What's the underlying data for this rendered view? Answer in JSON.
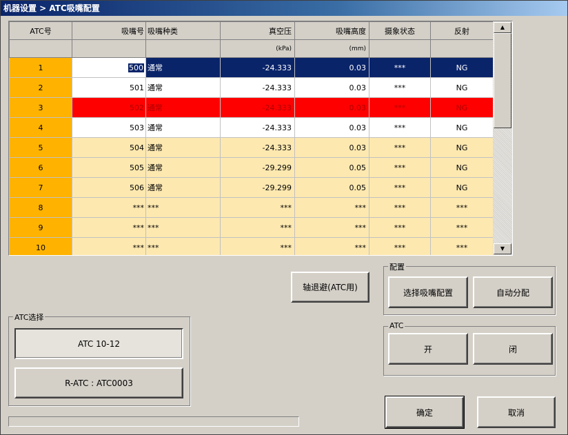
{
  "window": {
    "title": "机器设置 > ATC吸嘴配置"
  },
  "grid": {
    "headers": [
      "ATC号",
      "吸嘴号",
      "吸嘴种类",
      "真空压",
      "吸嘴高度",
      "摄象状态",
      "反射"
    ],
    "units": [
      "",
      "",
      "",
      "(kPa)",
      "(mm)",
      "",
      ""
    ],
    "rows": [
      [
        "1",
        "500",
        "通常",
        "-24.333",
        "0.03",
        "***",
        "NG"
      ],
      [
        "2",
        "501",
        "通常",
        "-24.333",
        "0.03",
        "***",
        "NG"
      ],
      [
        "3",
        "502",
        "通常",
        "-24.333",
        "0.03",
        "***",
        "NG"
      ],
      [
        "4",
        "503",
        "通常",
        "-24.333",
        "0.03",
        "***",
        "NG"
      ],
      [
        "5",
        "504",
        "通常",
        "-24.333",
        "0.03",
        "***",
        "NG"
      ],
      [
        "6",
        "505",
        "通常",
        "-29.299",
        "0.05",
        "***",
        "NG"
      ],
      [
        "7",
        "506",
        "通常",
        "-29.299",
        "0.05",
        "***",
        "NG"
      ],
      [
        "8",
        "***",
        "***",
        "***",
        "***",
        "***",
        "***"
      ],
      [
        "9",
        "***",
        "***",
        "***",
        "***",
        "***",
        "***"
      ],
      [
        "10",
        "***",
        "***",
        "***",
        "***",
        "***",
        "***"
      ]
    ],
    "row_styles": [
      "sel",
      "white",
      "err",
      "white",
      "yellow",
      "yellow",
      "yellow",
      "yellow",
      "yellow",
      "yellow"
    ],
    "colors": {
      "row_header": "#ffb300",
      "selected": "#0a246a",
      "error": "#ff0000",
      "inactive": "#fde8b0"
    }
  },
  "buttons": {
    "axis_retreat": "轴退避(ATC用)",
    "select_config": "选择吸嘴配置",
    "auto_assign": "自动分配",
    "open": "开",
    "close": "闭",
    "ok": "确定",
    "cancel": "取消",
    "atc_10_12": "ATC 10-12",
    "ratc": "R-ATC : ATC0003"
  },
  "groups": {
    "config": "配置",
    "atc": "ATC",
    "atc_select": "ATC选择"
  },
  "icons": {
    "scroll_up": "scroll-up-icon",
    "scroll_down": "scroll-down-icon"
  }
}
